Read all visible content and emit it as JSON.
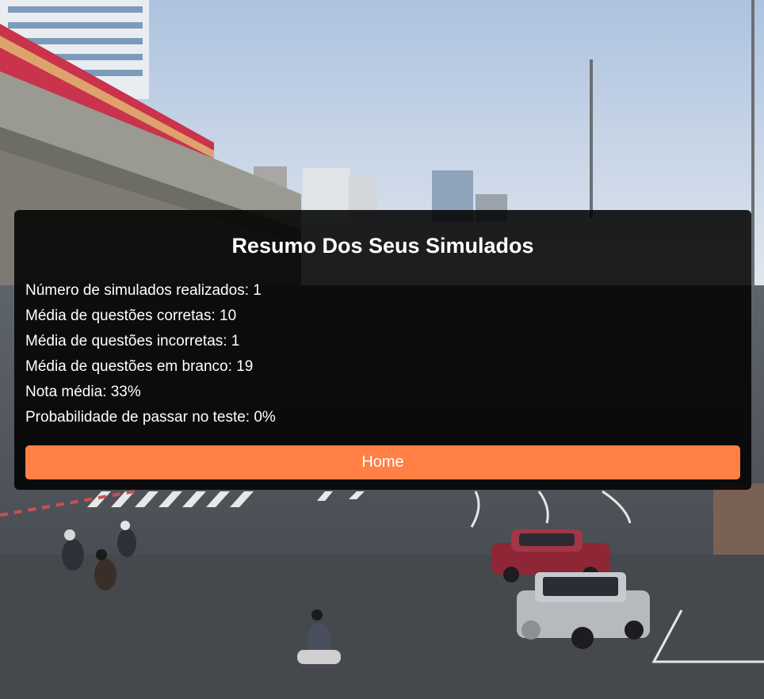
{
  "summary": {
    "title": "Resumo Dos Seus Simulados",
    "stats": [
      {
        "label": "Número de simulados realizados",
        "value": "1",
        "text": "Número de simulados realizados: 1"
      },
      {
        "label": "Média de questões corretas",
        "value": "10",
        "text": "Média de questões corretas: 10"
      },
      {
        "label": "Média de questões incorretas",
        "value": "1",
        "text": "Média de questões incorretas: 1"
      },
      {
        "label": "Média de questões em branco",
        "value": "19",
        "text": "Média de questões em branco: 19"
      },
      {
        "label": "Nota média",
        "value": "33%",
        "text": "Nota média: 33%"
      },
      {
        "label": "Probabilidade de passar no teste",
        "value": "0%",
        "text": "Probabilidade de passar no teste: 0%"
      }
    ],
    "home_button_label": "Home"
  },
  "colors": {
    "panel_background": "#000000",
    "button_accent": "#ff7f45",
    "text": "#ffffff"
  }
}
